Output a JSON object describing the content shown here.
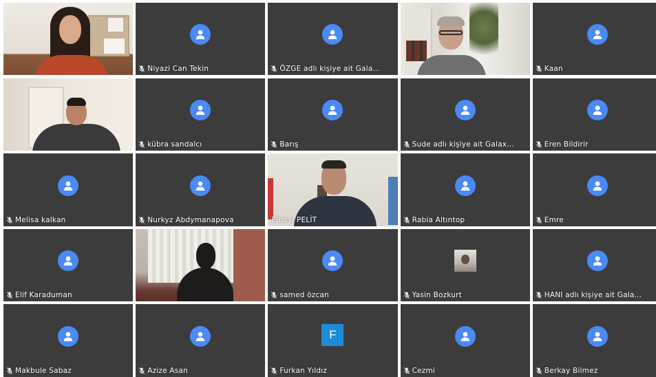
{
  "participants": [
    {
      "name": "",
      "type": "video",
      "scene": "woman"
    },
    {
      "name": "Niyazi Can Tekin",
      "type": "avatar"
    },
    {
      "name": "ÖZGE adlı kişiye ait Gala...",
      "type": "avatar"
    },
    {
      "name": "",
      "type": "video",
      "scene": "oldman"
    },
    {
      "name": "Kaan",
      "type": "avatar"
    },
    {
      "name": "",
      "type": "video",
      "scene": "man1"
    },
    {
      "name": "kübra sandalcı",
      "type": "avatar"
    },
    {
      "name": "Barış",
      "type": "avatar"
    },
    {
      "name": "Sude adlı kişiye ait Galax...",
      "type": "avatar"
    },
    {
      "name": "Eren Bildirir",
      "type": "avatar"
    },
    {
      "name": "Melisa kalkan",
      "type": "avatar"
    },
    {
      "name": "Nurkyz Abdymanapova",
      "type": "avatar"
    },
    {
      "name": "Elbeyi PELİT",
      "type": "video",
      "scene": "elbeyi",
      "muted": false
    },
    {
      "name": "Rabia Altıntop",
      "type": "avatar"
    },
    {
      "name": "Emre",
      "type": "avatar"
    },
    {
      "name": "Elif Karaduman",
      "type": "avatar"
    },
    {
      "name": "",
      "type": "video",
      "scene": "dark"
    },
    {
      "name": "samed özcan",
      "type": "avatar"
    },
    {
      "name": "Yasin Bozkurt",
      "type": "photo"
    },
    {
      "name": "HANI adlı kişiye ait Gala...",
      "type": "avatar"
    },
    {
      "name": "Makbule Sabaz",
      "type": "avatar"
    },
    {
      "name": "Azize Asan",
      "type": "avatar"
    },
    {
      "name": "Furkan Yıldız",
      "type": "letter",
      "letter": "F"
    },
    {
      "name": "Cezmi",
      "type": "avatar"
    },
    {
      "name": "Berkay Bilmez",
      "type": "avatar"
    }
  ],
  "colors": {
    "tile_bg": "#3c3c3c",
    "avatar_bg": "#4a8af4",
    "letter_avatar_bg": "#1f8ad8",
    "name_text": "#ffffff"
  },
  "icons": {
    "avatar": "person-icon",
    "muted": "mic-muted-icon"
  }
}
